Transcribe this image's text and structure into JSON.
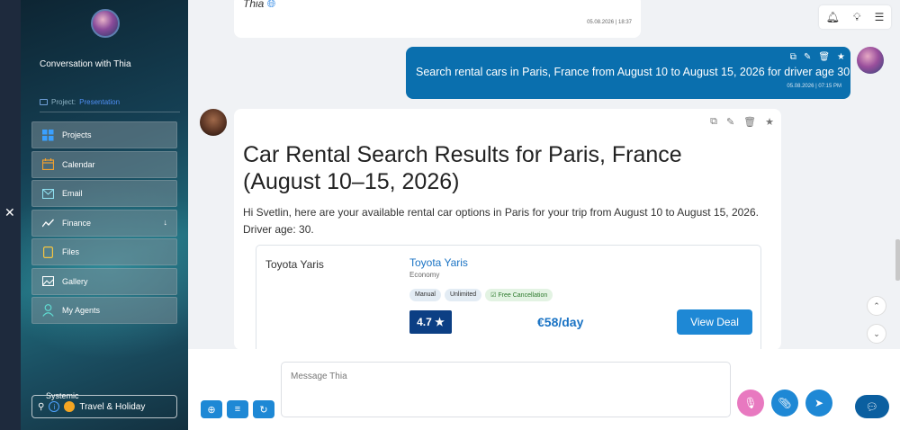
{
  "sidebar": {
    "conversation_title": "Conversation with Thia",
    "project_label": "Project:",
    "project_value": "Presentation",
    "items": [
      {
        "label": "Projects"
      },
      {
        "label": "Calendar"
      },
      {
        "label": "Email"
      },
      {
        "label": "Finance"
      },
      {
        "label": "Files"
      },
      {
        "label": "Gallery"
      },
      {
        "label": "My Agents"
      }
    ],
    "systemic_label": "Systemic",
    "travel_label": "Travel & Holiday"
  },
  "messages": {
    "previous": {
      "text": "Thia",
      "timestamp": "05.08.2026 | 18:37"
    },
    "user": {
      "text": "Search rental cars in Paris, France from August 10 to August 15, 2026 for driver age 30",
      "timestamp": "05.08.2026 | 07:15 PM"
    },
    "bot": {
      "title": "Car Rental Search Results for Paris, France (August 10–15, 2026)",
      "intro": "Hi Svetlin, here are your available rental car options in Paris for your trip from August 10 to August 15, 2026. Driver age: 30.",
      "card": {
        "left_label": "Toyota Yaris",
        "name": "Toyota Yaris",
        "class": "Economy",
        "tags": [
          "Manual",
          "Unlimited",
          "Free Cancellation"
        ],
        "rating": "4.7 ★",
        "price": "€58/day",
        "deal_label": "View Deal"
      }
    }
  },
  "composer": {
    "placeholder": "Message Thia"
  },
  "colors": {
    "accent": "#1e88d5",
    "user_bubble": "#0a6fae",
    "rating_bg": "#0c3f84",
    "mic": "#e879c0"
  }
}
